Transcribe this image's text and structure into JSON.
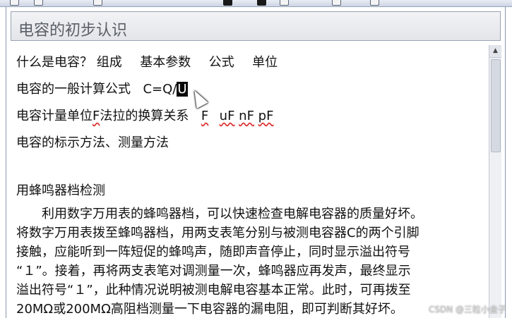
{
  "window": {
    "title": "电容的初步认识"
  },
  "content": {
    "outline": [
      [
        "什么是电容？",
        "组成",
        "基本参数",
        "公式",
        "单位"
      ],
      [
        "电容的一般计算公式",
        "C=Q/",
        "U"
      ],
      [
        "电容计量单位",
        "F",
        "法拉的换算关系",
        "F",
        "uF",
        "nF",
        "pF"
      ],
      [
        "电容的标示方法、测量方法"
      ]
    ],
    "section_heading": "用蜂鸣器档检测",
    "paragraph_lines": [
      "　　利用数字万用表的蜂鸣器档，可以快速检查电解电容器的质量好坏。",
      "将数字万用表拨至蜂鸣器档，用两支表笔分别与被测电容器C的两个引脚",
      "接触，应能听到一阵短促的蜂鸣声，随即声音停止，同时显示溢出符号",
      "“１”。接着，再将两支表笔对调测量一次，蜂鸣器应再发声，最终显示",
      "溢出符号“１”，此种情况说明被测电解电容基本正常。此时，可再拨至",
      "20MΩ或200MΩ高阻档测量一下电容器的漏电阻，即可判断其好坏。"
    ]
  },
  "watermark": "CSDN @三粒小金子",
  "icons": {
    "toolbar": [
      "toolbar-button-icon",
      "toolbar-button-icon",
      "toolbar-button-icon"
    ],
    "cursor": "mouse-pointer-icon",
    "scroll": "scroll-up-arrow-icon"
  },
  "colors": {
    "title_bg": "#e3e5ea",
    "selection": "#0a0a0a",
    "spell_underline": "#d33"
  }
}
